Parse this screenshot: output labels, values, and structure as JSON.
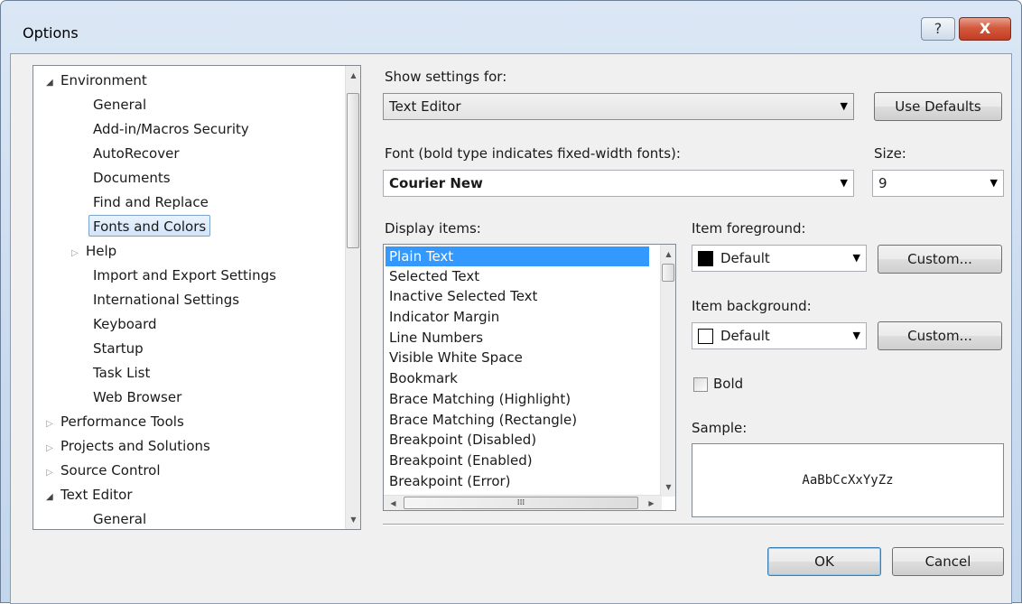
{
  "window": {
    "title": "Options",
    "help_glyph": "?",
    "close_glyph": "X"
  },
  "tree": {
    "items": [
      {
        "label": "Environment",
        "expander": "◢"
      },
      {
        "label": "General"
      },
      {
        "label": "Add-in/Macros Security"
      },
      {
        "label": "AutoRecover"
      },
      {
        "label": "Documents"
      },
      {
        "label": "Find and Replace"
      },
      {
        "label": "Fonts and Colors"
      },
      {
        "label": "Help",
        "expander": "▷"
      },
      {
        "label": "Import and Export Settings"
      },
      {
        "label": "International Settings"
      },
      {
        "label": "Keyboard"
      },
      {
        "label": "Startup"
      },
      {
        "label": "Task List"
      },
      {
        "label": "Web Browser"
      },
      {
        "label": "Performance Tools",
        "expander": "▷"
      },
      {
        "label": "Projects and Solutions",
        "expander": "▷"
      },
      {
        "label": "Source Control",
        "expander": "▷"
      },
      {
        "label": "Text Editor",
        "expander": "◢"
      },
      {
        "label": "General"
      }
    ]
  },
  "settings": {
    "show_settings_label": "Show settings for:",
    "show_settings_value": "Text Editor",
    "use_defaults_label": "Use Defaults",
    "font_label": "Font (bold type indicates fixed-width fonts):",
    "font_value": "Courier New",
    "size_label": "Size:",
    "size_value": "9",
    "display_items_label": "Display items:",
    "display_items": [
      "Plain Text",
      "Selected Text",
      "Inactive Selected Text",
      "Indicator Margin",
      "Line Numbers",
      "Visible White Space",
      "Bookmark",
      "Brace Matching (Highlight)",
      "Brace Matching (Rectangle)",
      "Breakpoint (Disabled)",
      "Breakpoint (Enabled)",
      "Breakpoint (Error)"
    ],
    "selected_display_item": "Plain Text",
    "item_foreground_label": "Item foreground:",
    "item_foreground_value": "Default",
    "item_foreground_color": "#000000",
    "item_background_label": "Item background:",
    "item_background_value": "Default",
    "item_background_color": "#ffffff",
    "custom_label": "Custom...",
    "bold_label": "Bold",
    "bold_checked": false,
    "sample_label": "Sample:",
    "sample_text": "AaBbCcXxYyZz"
  },
  "footer": {
    "ok_label": "OK",
    "cancel_label": "Cancel"
  },
  "colors": {
    "selection": "#3399ff",
    "close_button": "#c33c22",
    "titlebar": "#dbe7f5"
  },
  "icons": {
    "dropdown": "chevron-down-icon",
    "expand": "triangle-right-icon",
    "collapse": "triangle-down-icon"
  }
}
